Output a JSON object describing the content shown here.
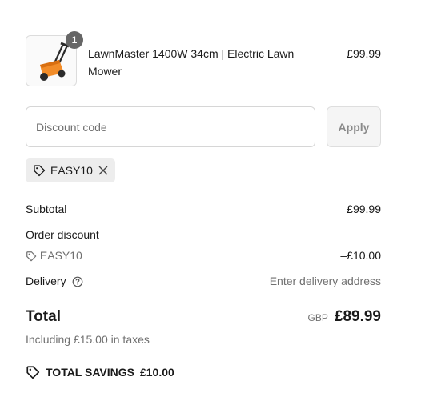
{
  "product": {
    "name": "LawnMaster 1400W 34cm | Electric Lawn Mower",
    "price": "£99.99",
    "quantity": "1",
    "image_icon": "lawn-mower-image"
  },
  "discount": {
    "placeholder": "Discount code",
    "apply_label": "Apply",
    "applied_code": "EASY10"
  },
  "summary": {
    "subtotal_label": "Subtotal",
    "subtotal_value": "£99.99",
    "order_discount_label": "Order discount",
    "order_discount_code": "EASY10",
    "order_discount_value": "–£10.00",
    "delivery_label": "Delivery",
    "delivery_value": "Enter delivery address",
    "total_label": "Total",
    "total_currency": "GBP",
    "total_value": "£89.99",
    "taxes_note": "Including £15.00 in taxes",
    "savings_label": "TOTAL SAVINGS",
    "savings_value": "£10.00"
  },
  "colors": {
    "badge": "#666666",
    "muted_text": "#707070",
    "chip_bg": "#ededed",
    "apply_bg": "#f5f5f5",
    "mower_orange": "#f28c28"
  }
}
